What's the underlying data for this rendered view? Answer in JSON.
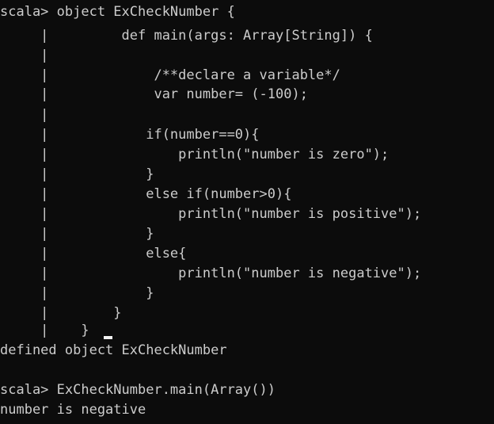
{
  "terminal": {
    "lines": [
      "scala> object ExCheckNumber {",
      "     |         def main(args: Array[String]) {",
      "     |",
      "     |             /**declare a variable*/",
      "     |             var number= (-100);",
      "     |",
      "     |            if(number==0){",
      "     |                println(\"number is zero\");",
      "     |            }",
      "     |            else if(number>0){",
      "     |                println(\"number is positive\");",
      "     |            }",
      "     |            else{",
      "     |                println(\"number is negative\");",
      "     |            }",
      "     |        }",
      "     |    }",
      "defined object ExCheckNumber",
      "",
      "scala> ExCheckNumber.main(Array())",
      "number is negative"
    ]
  },
  "colors": {
    "background": "#0c0c0c",
    "text": "#cccccc",
    "cursor": "#f2f2f2"
  }
}
